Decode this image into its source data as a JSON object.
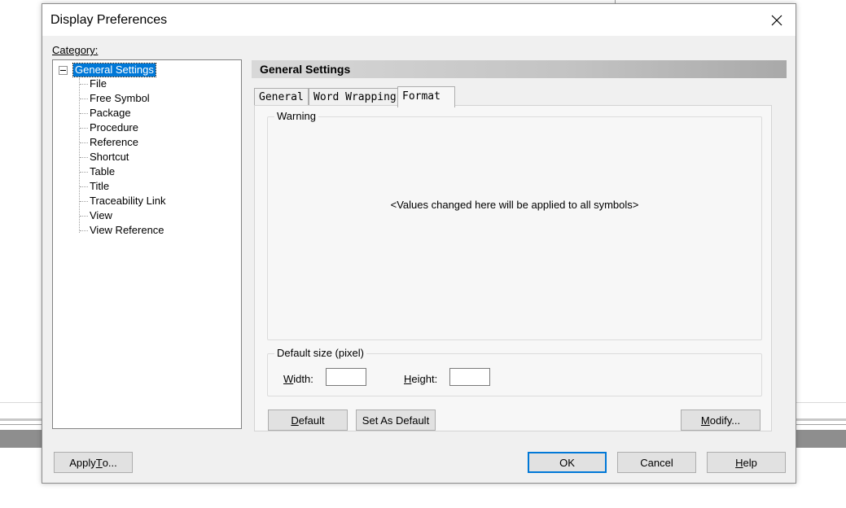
{
  "dialog": {
    "title": "Display Preferences",
    "category_label": "Category:",
    "panel_title": "General Settings"
  },
  "tree": {
    "root": "General Settings",
    "children": [
      "File",
      "Free Symbol",
      "Package",
      "Procedure",
      "Reference",
      "Shortcut",
      "Table",
      "Title",
      "Traceability Link",
      "View",
      "View Reference"
    ]
  },
  "tabs": [
    {
      "label": "General",
      "active": false
    },
    {
      "label": "Word Wrapping",
      "active": false
    },
    {
      "label": "Format",
      "active": true
    }
  ],
  "format_tab": {
    "warning_group_title": "Warning",
    "warning_message": "<Values changed here will be applied to all symbols>",
    "size_group_title": "Default size (pixel)",
    "width_label_pre": "",
    "width_label_key": "W",
    "width_label_post": "idth:",
    "width_value": "",
    "height_label_pre": "",
    "height_label_key": "H",
    "height_label_post": "eight:",
    "height_value": "",
    "default_btn_pre": "",
    "default_btn_key": "D",
    "default_btn_post": "efault",
    "set_default_btn": "Set As Default",
    "modify_btn_pre": "",
    "modify_btn_key": "M",
    "modify_btn_post": "odify..."
  },
  "footer": {
    "apply_pre": "Apply ",
    "apply_key": "T",
    "apply_post": "o...",
    "ok": "OK",
    "cancel": "Cancel",
    "help_pre": "",
    "help_key": "H",
    "help_post": "elp"
  },
  "colors": {
    "selection": "#0078d7",
    "dialog_bg": "#f0f0f0"
  }
}
